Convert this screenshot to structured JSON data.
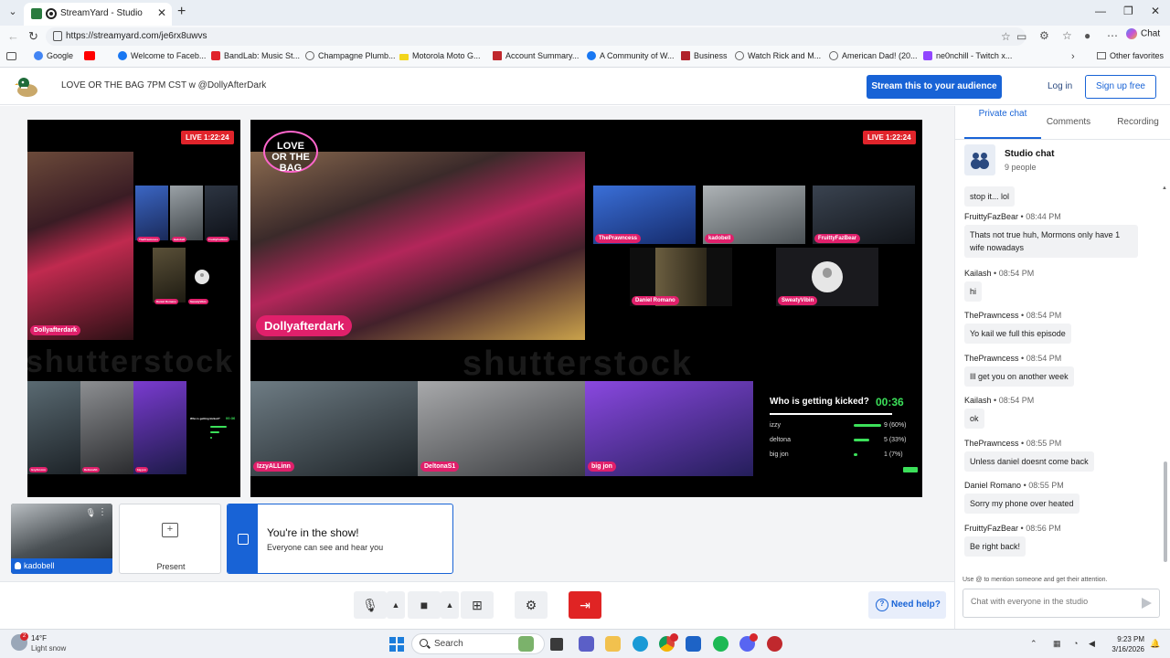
{
  "browser": {
    "tab_title": "StreamYard - Studio",
    "url": "https://streamyard.com/je6rx8uwvs",
    "copilot_label": "Chat",
    "bookmarks": [
      {
        "label": "Google",
        "color": "#4285f4"
      },
      {
        "label": "",
        "color": "#ff0000"
      },
      {
        "label": "Welcome to Faceb...",
        "color": "#1877f2"
      },
      {
        "label": "BandLab: Music St...",
        "color": "#e0242b"
      },
      {
        "label": "Champagne Plumb...",
        "color": "#666666"
      },
      {
        "label": "Motorola Moto G...",
        "color": "#f2d51c"
      },
      {
        "label": "Account Summary...",
        "color": "#c0282d"
      },
      {
        "label": "A Community of W...",
        "color": "#1877f2"
      },
      {
        "label": "Business",
        "color": "#b0222a"
      },
      {
        "label": "Watch Rick and M...",
        "color": "#666666"
      },
      {
        "label": "American Dad! (20...",
        "color": "#666666"
      },
      {
        "label": "ne0nchill - Twitch x...",
        "color": "#9146ff"
      }
    ],
    "other_favorites": "Other favorites"
  },
  "header": {
    "broadcast_title": "LOVE OR THE BAG 7PM CST w @DollyAfterDark",
    "stream_button": "Stream this to your audience",
    "login": "Log in",
    "signup": "Sign up free"
  },
  "stage": {
    "live_small": "LIVE 1:22:24",
    "live_main": "LIVE 1:22:24",
    "watermark": "shutterstock",
    "host_name": "Dollyafterdark",
    "small_names": [
      "ThePrawncess",
      "kadobell",
      "FruittyFazBear",
      "Daniel Romano",
      "SweatyVibin",
      "IzzyALLinn",
      "DeltonaS1",
      "big jon"
    ],
    "guest_names": [
      "ThePrawncess",
      "kadobell",
      "FruittyFazBear",
      "Daniel Romano",
      "SweatyVibin"
    ],
    "bottom_names": [
      "IzzyALLinn",
      "DeltonaS1",
      "big jon"
    ],
    "poll": {
      "question": "Who is getting kicked?",
      "timer": "00:36",
      "options": [
        {
          "name": "izzy",
          "result": "9 (60%)",
          "share": 0.6
        },
        {
          "name": "deltona",
          "result": "5 (33%)",
          "share": 0.33
        },
        {
          "name": "big jon",
          "result": "1 (7%)",
          "share": 0.07
        }
      ]
    }
  },
  "tiles": {
    "self_name": "kadobell",
    "present_label": "Present",
    "in_show_title": "You're in the show!",
    "in_show_sub": "Everyone can see and hear you"
  },
  "controls": {
    "help": "Need help?"
  },
  "sidebar": {
    "tabs": [
      "Private chat",
      "Comments",
      "Recording"
    ],
    "studio_chat_title": "Studio chat",
    "people_count": "9 people",
    "first_bubble": "stop it... lol",
    "messages": [
      {
        "author": "FruittyFazBear",
        "time": "08:44 PM",
        "text": "Thats not true huh, Mormons only have 1 wife nowadays"
      },
      {
        "author": "Kailash",
        "time": "08:54 PM",
        "text": "hi"
      },
      {
        "author": "ThePrawncess",
        "time": "08:54 PM",
        "text": "Yo kail we full this episode"
      },
      {
        "author": "ThePrawncess",
        "time": "08:54 PM",
        "text": "Ill get you on another week"
      },
      {
        "author": "Kailash",
        "time": "08:54 PM",
        "text": "ok"
      },
      {
        "author": "ThePrawncess",
        "time": "08:55 PM",
        "text": "Unless daniel doesnt come back"
      },
      {
        "author": "Daniel Romano",
        "time": "08:55 PM",
        "text": "Sorry my phone over heated"
      },
      {
        "author": "FruittyFazBear",
        "time": "08:56 PM",
        "text": "Be right back!"
      }
    ],
    "separator": "•",
    "mention_hint": "Use @ to mention someone and get their attention.",
    "chat_placeholder": "Chat with everyone in the studio"
  },
  "taskbar": {
    "temperature": "14°F",
    "weather": "Light snow",
    "weather_badge": "2",
    "search": "Search",
    "time": "9:23 PM",
    "date": "3/16/2026"
  }
}
